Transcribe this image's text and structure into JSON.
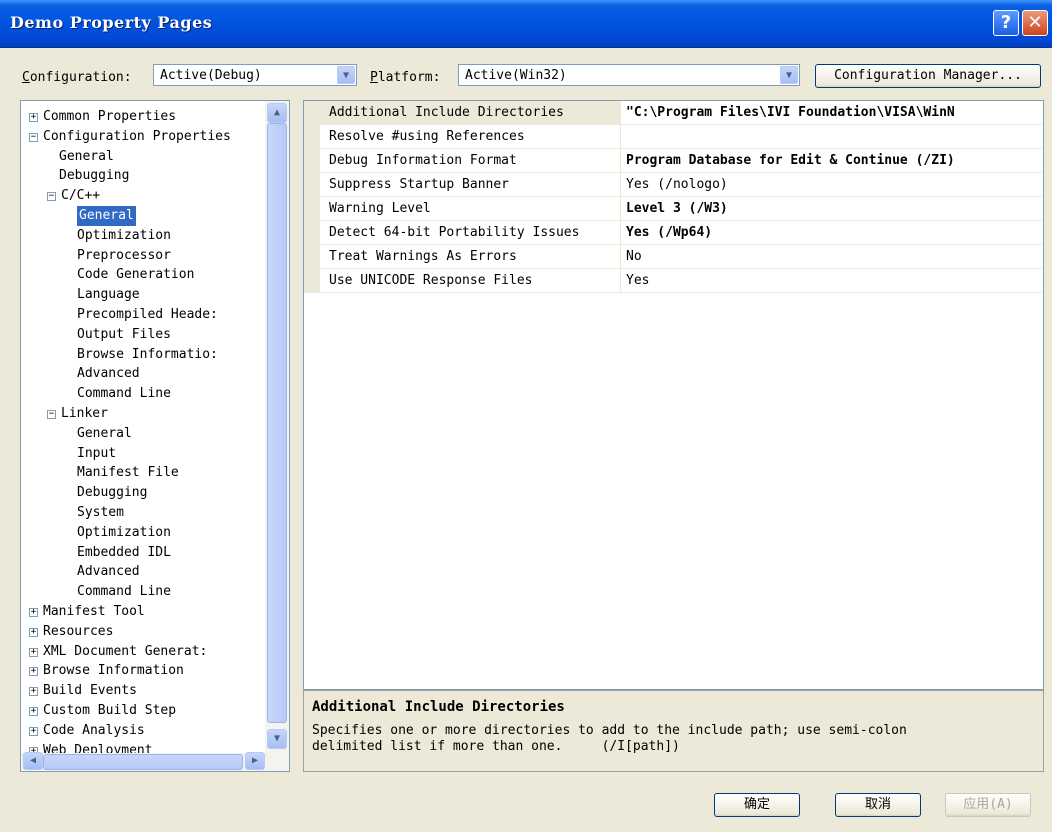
{
  "window": {
    "title": "Demo Property Pages",
    "help": "?",
    "close": "✕"
  },
  "config_bar": {
    "configuration_label_key": "C",
    "configuration_label_rest": "onfiguration:",
    "configuration_value": "Active(Debug)",
    "platform_label_key": "P",
    "platform_label_rest": "latform:",
    "platform_value": "Active(Win32)",
    "config_manager": "Configuration Manager..."
  },
  "tree": {
    "nodes": [
      {
        "label": "Common Properties",
        "exp": "+"
      },
      {
        "label": "Configuration Properties",
        "exp": "−"
      },
      {
        "label": "General"
      },
      {
        "label": "Debugging"
      },
      {
        "label": "C/C++",
        "exp": "−"
      },
      {
        "label": "General",
        "selected": true
      },
      {
        "label": "Optimization"
      },
      {
        "label": "Preprocessor"
      },
      {
        "label": "Code Generation"
      },
      {
        "label": "Language"
      },
      {
        "label": "Precompiled Heade:"
      },
      {
        "label": "Output Files"
      },
      {
        "label": "Browse Informatio:"
      },
      {
        "label": "Advanced"
      },
      {
        "label": "Command Line"
      },
      {
        "label": "Linker",
        "exp": "−"
      },
      {
        "label": "General"
      },
      {
        "label": "Input"
      },
      {
        "label": "Manifest File"
      },
      {
        "label": "Debugging"
      },
      {
        "label": "System"
      },
      {
        "label": "Optimization"
      },
      {
        "label": "Embedded IDL"
      },
      {
        "label": "Advanced"
      },
      {
        "label": "Command Line"
      },
      {
        "label": "Manifest Tool",
        "exp": "+"
      },
      {
        "label": "Resources",
        "exp": "+"
      },
      {
        "label": "XML Document Generat:",
        "exp": "+"
      },
      {
        "label": "Browse Information",
        "exp": "+"
      },
      {
        "label": "Build Events",
        "exp": "+"
      },
      {
        "label": "Custom Build Step",
        "exp": "+"
      },
      {
        "label": "Code Analysis",
        "exp": "+"
      },
      {
        "label": "Web Deployment",
        "exp": "+"
      }
    ]
  },
  "properties": [
    {
      "name": "Additional Include Directories",
      "value": "\"C:\\Program Files\\IVI Foundation\\VISA\\WinN",
      "bold": true
    },
    {
      "name": "Resolve #using References",
      "value": "",
      "bold": false
    },
    {
      "name": "Debug Information Format",
      "value": "Program Database for Edit & Continue (/ZI)",
      "bold": true
    },
    {
      "name": "Suppress Startup Banner",
      "value": "Yes (/nologo)",
      "bold": false
    },
    {
      "name": "Warning Level",
      "value": "Level 3 (/W3)",
      "bold": true
    },
    {
      "name": "Detect 64-bit Portability Issues",
      "value": "Yes (/Wp64)",
      "bold": true
    },
    {
      "name": "Treat Warnings As Errors",
      "value": "No",
      "bold": false
    },
    {
      "name": "Use UNICODE Response Files",
      "value": "Yes",
      "bold": false
    }
  ],
  "description": {
    "title": "Additional Include Directories",
    "text": "Specifies one or more directories to add to the include path; use semi-colon\ndelimited list if more than one.     (/I[path])"
  },
  "footer": {
    "ok": "确定",
    "cancel": "取消",
    "apply": "应用(A)"
  }
}
